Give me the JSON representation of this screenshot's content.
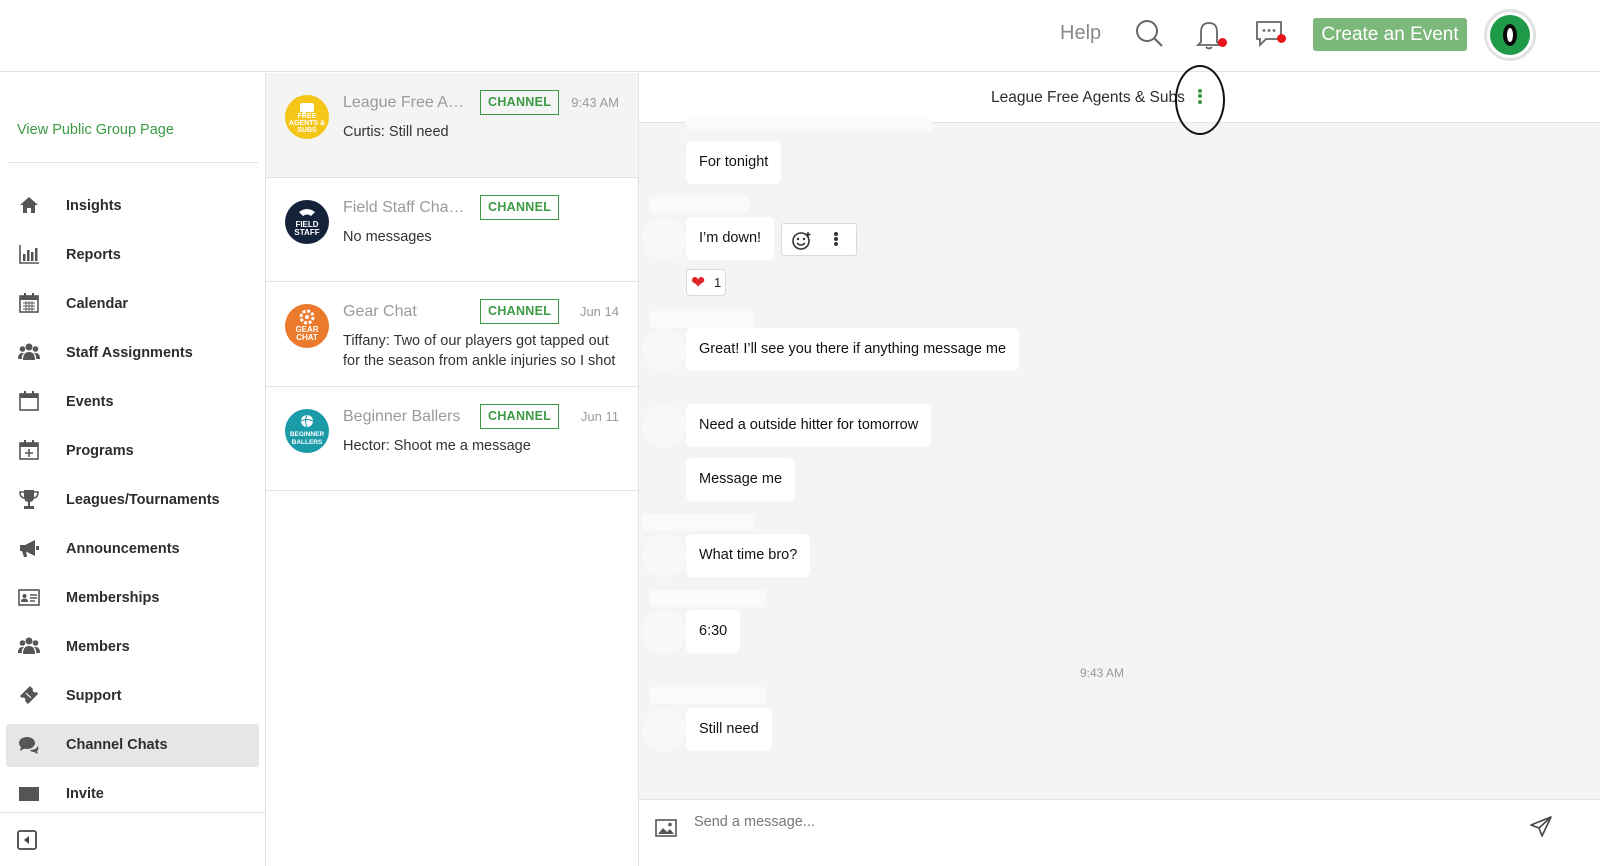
{
  "header": {
    "help_label": "Help",
    "create_event_label": "Create an Event",
    "search_icon": "search-icon",
    "notifications_icon": "bell-icon",
    "messages_icon": "chat-bubble-icon",
    "accent_color": "#7cb87a",
    "alert_dot_color": "#e8141b"
  },
  "sidebar": {
    "public_link": "View Public Group Page",
    "items": [
      {
        "label": "Insights",
        "icon": "home-icon"
      },
      {
        "label": "Reports",
        "icon": "bar-chart-icon"
      },
      {
        "label": "Calendar",
        "icon": "calendar-grid-icon"
      },
      {
        "label": "Staff Assignments",
        "icon": "people-icon"
      },
      {
        "label": "Events",
        "icon": "calendar-icon"
      },
      {
        "label": "Programs",
        "icon": "calendar-plus-icon"
      },
      {
        "label": "Leagues/Tournaments",
        "icon": "trophy-icon"
      },
      {
        "label": "Announcements",
        "icon": "megaphone-icon"
      },
      {
        "label": "Memberships",
        "icon": "id-card-icon"
      },
      {
        "label": "Members",
        "icon": "people-icon"
      },
      {
        "label": "Support",
        "icon": "ticket-icon"
      },
      {
        "label": "Channel Chats",
        "icon": "chat-icon",
        "active": true
      },
      {
        "label": "Invite",
        "icon": "envelope-icon"
      }
    ]
  },
  "channels": [
    {
      "name": "League Free Ag...",
      "badge": "CHANNEL",
      "time": "9:43 AM",
      "preview": "Curtis: Still need",
      "logo_text": [
        "FREE",
        "AGENTS &",
        "SUBS"
      ],
      "logo_color": "#f5c518",
      "selected": true
    },
    {
      "name": "Field Staff Chan...",
      "badge": "CHANNEL",
      "time": "",
      "preview": "No messages",
      "logo_text": [
        "FIELD",
        "STAFF"
      ],
      "logo_color": "#14223a",
      "selected": false
    },
    {
      "name": "Gear Chat",
      "badge": "CHANNEL",
      "time": "Jun 14",
      "preview": "Tiffany: Two of our players got tapped out for the season from ankle injuries so I shot",
      "logo_text": [
        "GEAR",
        "CHAT"
      ],
      "logo_color": "#ec7a2c",
      "selected": false
    },
    {
      "name": "Beginner Ballers",
      "badge": "CHANNEL",
      "time": "Jun 11",
      "preview": "Hector: Shoot me a message",
      "logo_text": [
        "BEGINNER",
        "BALLERS"
      ],
      "logo_color": "#1b9aa8",
      "selected": false
    }
  ],
  "chat": {
    "title": "League Free Agents & Subs",
    "messages": [
      {
        "text": "For tonight"
      },
      {
        "text": "I’m down!"
      },
      {
        "text": "Great! I’ll see you there if anything message me"
      },
      {
        "text": "Need a outside hitter for tomorrow"
      },
      {
        "text": "Message me"
      },
      {
        "text": "What time bro?"
      },
      {
        "text": "6:30"
      },
      {
        "text": "Still need"
      }
    ],
    "reaction": {
      "emoji": "❤",
      "count": "1"
    },
    "timestamp": "9:43 AM",
    "composer_placeholder": "Send a message..."
  }
}
